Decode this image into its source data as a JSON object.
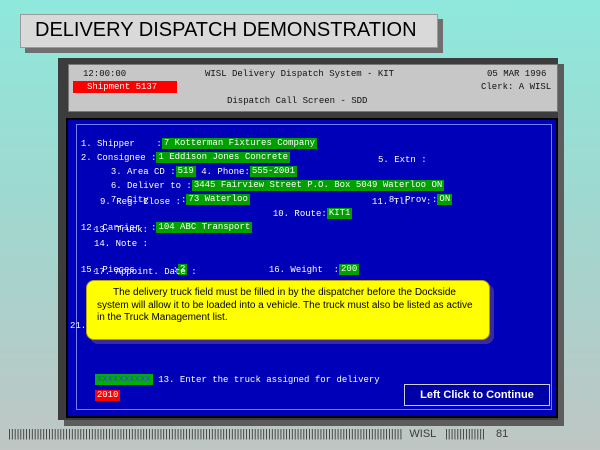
{
  "slide": {
    "title": "DELIVERY DISPATCH DEMONSTRATION",
    "continue_label": "Left Click to Continue",
    "footer_bars_left": "||||||||||||||||||||||||||||||||||||||||||||||||||||||||||||||||||||||||||||||||||||||||||||||||||||||||||||||||||||||||||||||||||||||||||",
    "footer_brand": "WISL",
    "footer_bars_right": "||||||||||||||",
    "page_number": "81",
    "callout_text": "The delivery truck field must be filled in by the dispatcher before the Dockside system will allow it to be loaded into a vehicle. The truck must also be listed as active in the Truck Management list."
  },
  "header": {
    "time": "12:00:00",
    "system_title": "WISL Delivery Dispatch System - KIT",
    "date": "05 MAR 1996",
    "shipment_badge": "Shipment 5137",
    "clerk": "Clerk: A WISL",
    "screen_name": "Dispatch Call Screen - SDD"
  },
  "form": {
    "shipper_label": "1. Shipper    :",
    "shipper_value": "7 Kotterman Fixtures Company",
    "consignee_label": "2. Consignee :",
    "consignee_value": "1 Eddison Jones Concrete",
    "area_label": "3. Area CD :",
    "area_value": "519",
    "phone_label": "4. Phone:",
    "phone_value": "555-2001",
    "extn_label": "5. Extn :",
    "deliver_label": "6. Deliver to :",
    "deliver_value": "3445 Fairview Street P.O. Box 5049 Waterloo ON",
    "city_label": "7. City      :",
    "city_value": "73 Waterloo",
    "prov_label": "8. Prov :",
    "prov_value": "ON",
    "regclose_label": "9. Reg. Close :",
    "route_label": "10. Route:",
    "route_value": "KIT1",
    "tlr_label": "11. Tlr   :",
    "carrier_label": "12. Carrier  :",
    "carrier_value": "104 ABC Transport",
    "truck_label": "13. Truck:",
    "note_label": "14. Note :",
    "pieces_label": "15. Pieces       :",
    "pieces_value": "2",
    "weight_label": "16. Weight  :",
    "weight_value": "200",
    "appoint_label": "17. Appoint. Date :",
    "row21_label": "21.",
    "prompt_field": "xxxxxxxxxx",
    "prompt_text": "13. Enter the truck assigned for delivery",
    "truck_entry": "2010"
  },
  "colors": {
    "field_green": "#00a000",
    "screen_blue": "#0000b8",
    "badge_red": "#ff0000",
    "callout_yellow": "#ffff00"
  }
}
